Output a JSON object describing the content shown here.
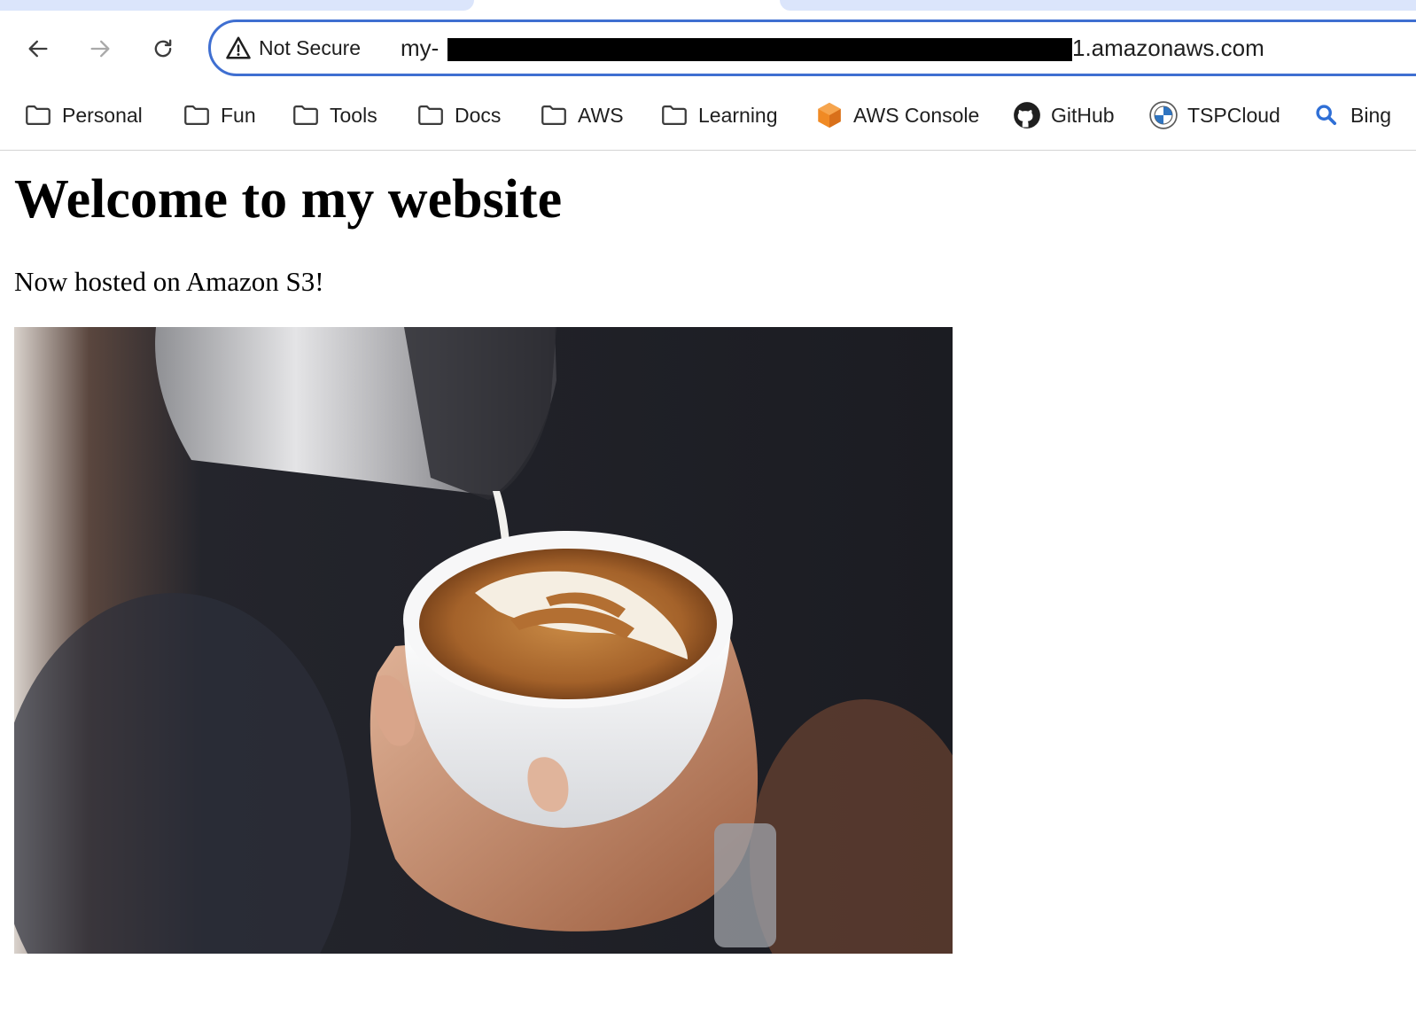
{
  "browser": {
    "security_label": "Not Secure",
    "url_prefix": "my-",
    "url_suffix": "1.amazonaws.com"
  },
  "bookmarks": [
    {
      "label": "Personal",
      "icon": "folder-icon"
    },
    {
      "label": "Fun",
      "icon": "folder-icon"
    },
    {
      "label": "Tools",
      "icon": "folder-icon"
    },
    {
      "label": "Docs",
      "icon": "folder-icon"
    },
    {
      "label": "AWS",
      "icon": "folder-icon"
    },
    {
      "label": "Learning",
      "icon": "folder-icon"
    },
    {
      "label": "AWS Console",
      "icon": "aws-cube-icon"
    },
    {
      "label": "GitHub",
      "icon": "github-icon"
    },
    {
      "label": "TSPCloud",
      "icon": "bmw-logo-icon"
    },
    {
      "label": "Bing",
      "icon": "search-icon"
    }
  ],
  "page": {
    "heading": "Welcome to my website",
    "subtitle": "Now hosted on Amazon S3!"
  },
  "colors": {
    "omnibox_border": "#3f6fd1",
    "tab_background": "#dbe5fb",
    "aws_orange": "#f08a24",
    "bing_blue": "#2f6fd6"
  }
}
